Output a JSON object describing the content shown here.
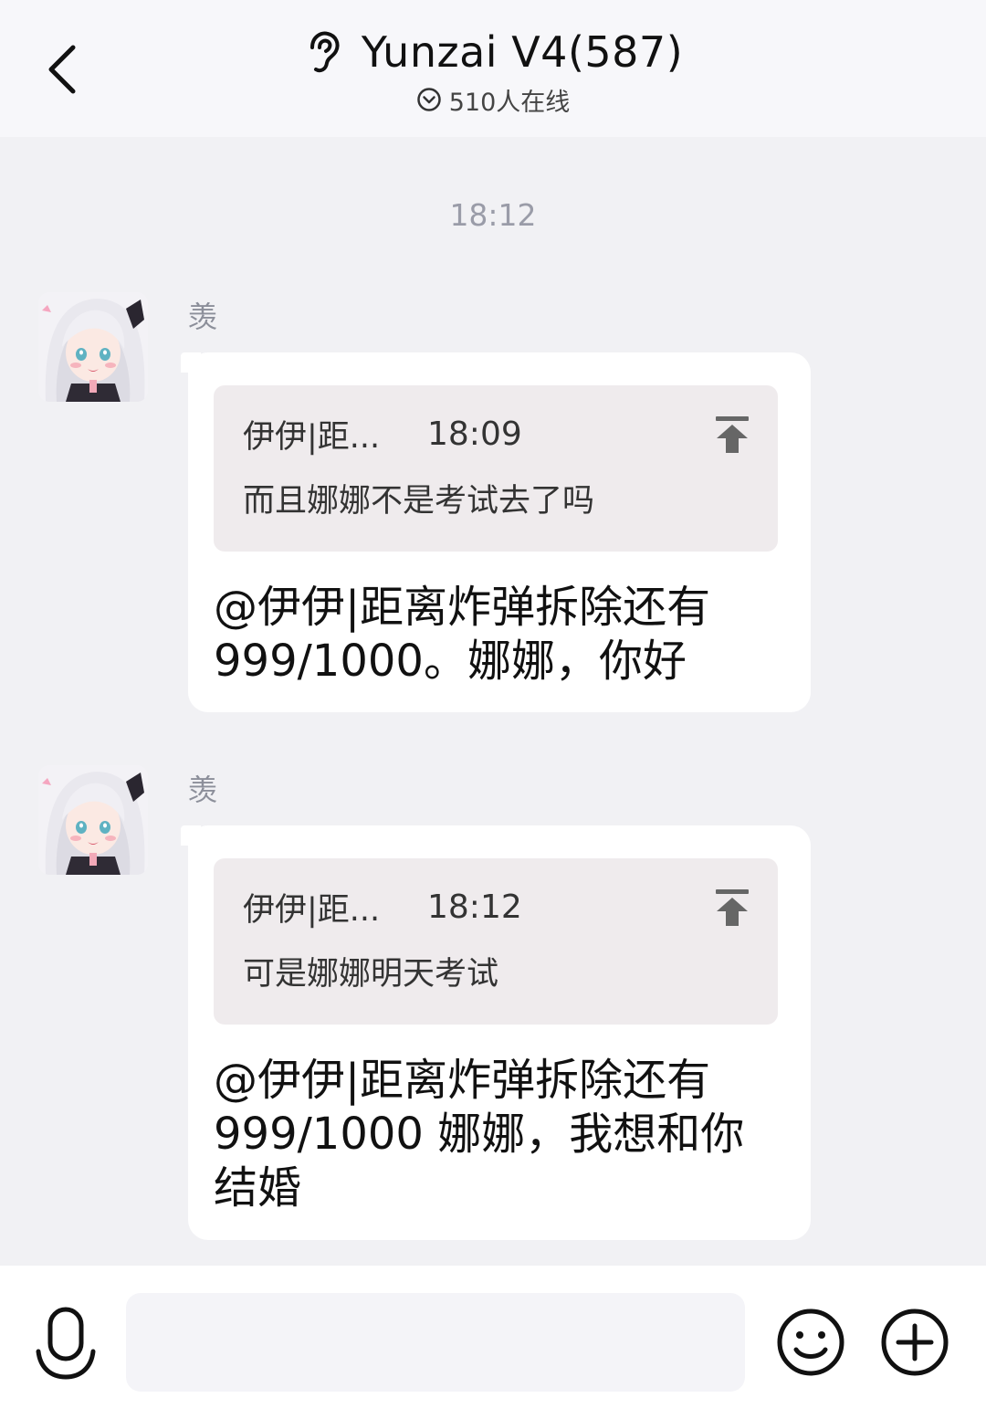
{
  "header": {
    "title": "Yunzai V4(587)",
    "online": "510人在线"
  },
  "chat": {
    "time_separator": "18:12",
    "messages": [
      {
        "sender": "羡",
        "quote": {
          "name": "伊伊|距...",
          "time": "18:09",
          "text": "而且娜娜不是考试去了吗"
        },
        "text": "@伊伊|距离炸弹拆除还有999/1000。娜娜，你好"
      },
      {
        "sender": "羡",
        "quote": {
          "name": "伊伊|距...",
          "time": "18:12",
          "text": "可是娜娜明天考试"
        },
        "text": "@伊伊|距离炸弹拆除还有999/1000 娜娜，我想和你结婚"
      }
    ]
  },
  "input": {
    "placeholder": ""
  },
  "colors": {
    "header_bg": "#f7f7fa",
    "chat_bg": "#f1f1f4",
    "bubble_bg": "#ffffff",
    "quote_bg": "#efebed",
    "meta_text": "#9a9ca8"
  },
  "icons": {
    "back": "chevron-left-icon",
    "ear": "ear-icon",
    "online": "chevron-down-circle-icon",
    "jump": "jump-to-top-icon",
    "mic": "microphone-icon",
    "emoji": "smiley-icon",
    "plus": "plus-circle-icon"
  }
}
